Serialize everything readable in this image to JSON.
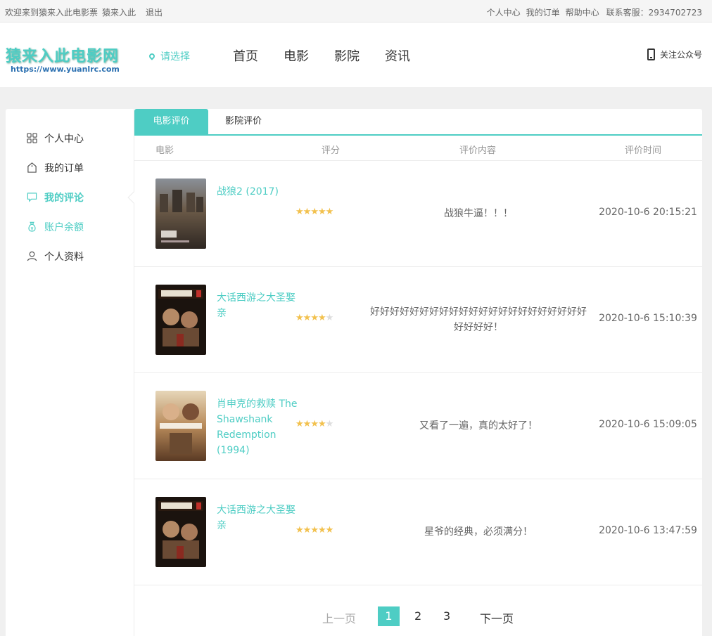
{
  "topbar": {
    "welcome": "欢迎来到猿来入此电影票",
    "username": "猿来入此",
    "logout": "退出",
    "links": [
      "个人中心",
      "我的订单",
      "帮助中心"
    ],
    "service": "联系客服：2934702723"
  },
  "header": {
    "logo_text": "猿来入此电影网",
    "logo_url": "https://www.yuanlrc.com",
    "city_label": "请选择",
    "nav": [
      "首页",
      "电影",
      "影院",
      "资讯"
    ],
    "follow": "关注公众号"
  },
  "sidebar": {
    "items": [
      {
        "label": "个人中心",
        "icon": "grid-icon"
      },
      {
        "label": "我的订单",
        "icon": "bag-icon"
      },
      {
        "label": "我的评论",
        "icon": "comment-icon"
      },
      {
        "label": "账户余额",
        "icon": "money-bag-icon"
      },
      {
        "label": "个人资料",
        "icon": "user-icon"
      }
    ]
  },
  "tabs": [
    "电影评价",
    "影院评价"
  ],
  "columns": [
    "电影",
    "评分",
    "评价内容",
    "评价时间"
  ],
  "reviews": [
    {
      "title": "战狼2 (2017)",
      "stars": 5,
      "comment": "战狼牛逼！！！",
      "time": "2020-10-6 20:15:21"
    },
    {
      "title": "大话西游之大圣娶亲",
      "stars": 4.5,
      "comment": "好好好好好好好好好好好好好好好好好好好好好好好好好好！",
      "time": "2020-10-6 15:10:39"
    },
    {
      "title": "肖申克的救赎 The Shawshank Redemption (1994)",
      "stars": 4.5,
      "comment": "又看了一遍，真的太好了！",
      "time": "2020-10-6 15:09:05"
    },
    {
      "title": "大话西游之大圣娶亲",
      "stars": 5,
      "comment": "星爷的经典，必须满分！",
      "time": "2020-10-6 13:47:59"
    }
  ],
  "pager": {
    "prev": "上一页",
    "pages": [
      "1",
      "2",
      "3"
    ],
    "current": "1",
    "next": "下一页"
  },
  "colors": {
    "accent": "#4ecdc4",
    "star": "#f2c14e"
  }
}
